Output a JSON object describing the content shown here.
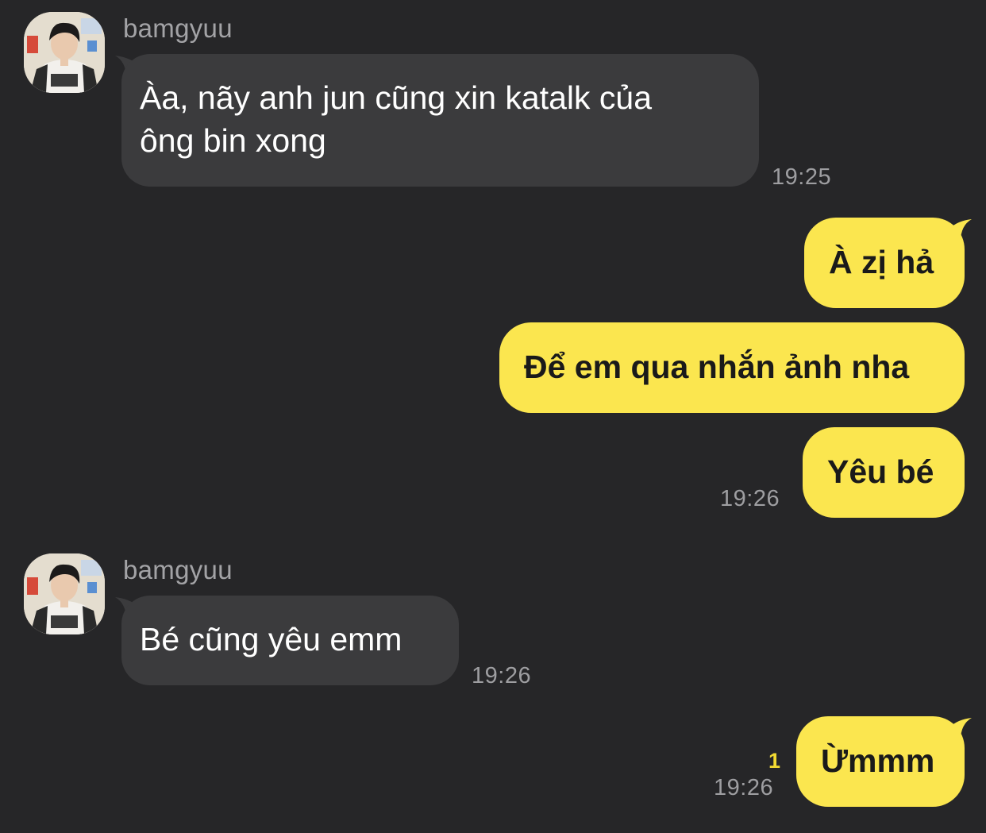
{
  "conversation": {
    "messages": [
      {
        "sender": "bamgyuu",
        "direction": "in",
        "text": "Àa, nãy anh jun cũng xin katalk của\nông bin xong",
        "time": "19:25"
      },
      {
        "direction": "out",
        "text": "À zị hả"
      },
      {
        "direction": "out",
        "text": "Để em qua nhắn ảnh nha"
      },
      {
        "direction": "out",
        "text": "Yêu bé",
        "time": "19:26"
      },
      {
        "sender": "bamgyuu",
        "direction": "in",
        "text": "Bé cũng yêu emm",
        "time": "19:26"
      },
      {
        "direction": "out",
        "text": "Ừmmm",
        "time": "19:26",
        "unread": "1"
      }
    ]
  },
  "colors": {
    "background": "#262628",
    "incoming_bubble": "#3b3b3d",
    "outgoing_bubble": "#fbe64f",
    "unread_badge": "#f2da32"
  },
  "icons": {
    "avatar": "profile-photo"
  }
}
